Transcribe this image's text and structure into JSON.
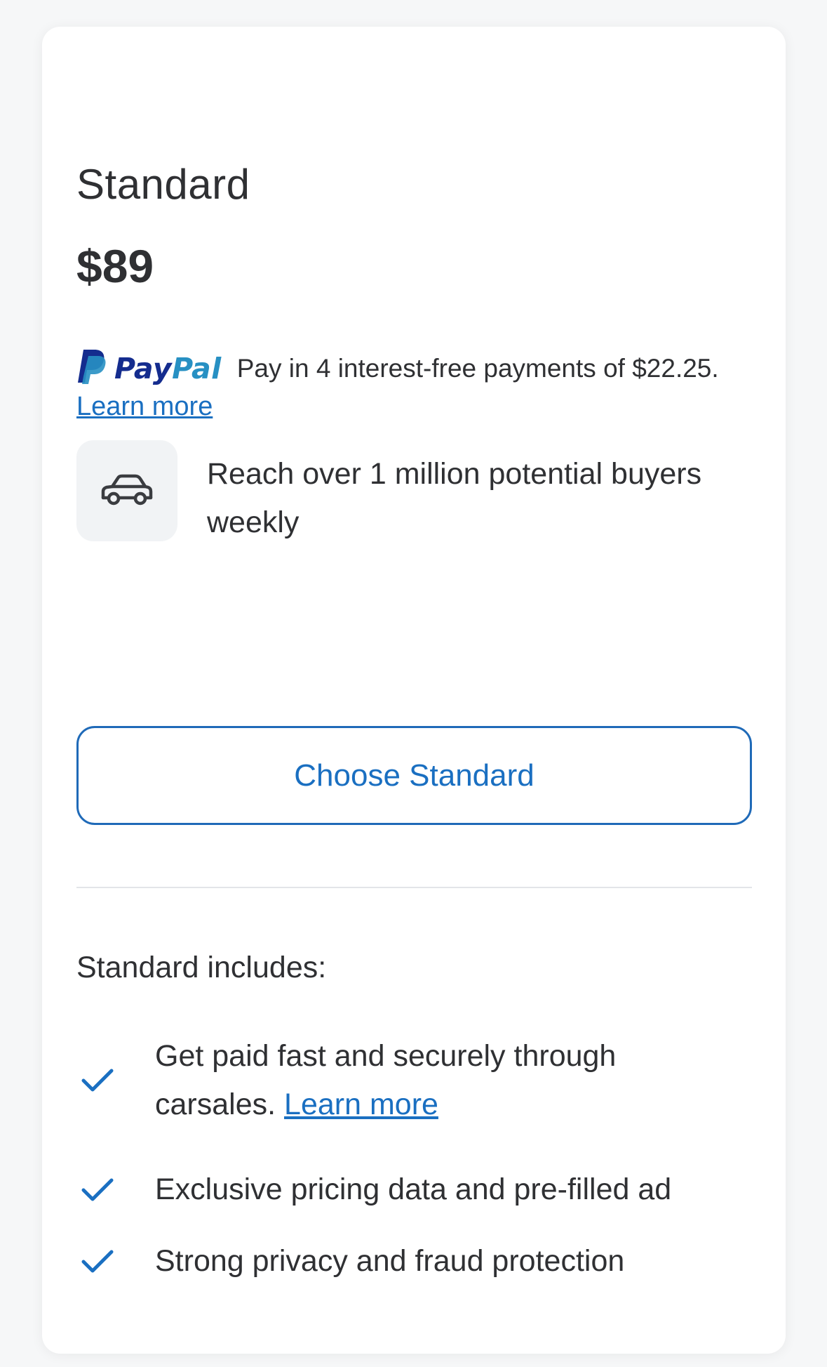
{
  "plan": {
    "name": "Standard",
    "price": "$89"
  },
  "paypal": {
    "logo_pay": "Pay",
    "logo_pal": "Pal",
    "text": "Pay in 4 interest-free payments of $22.25.",
    "learn_more": "Learn more",
    "colors": {
      "dark": "#142c8e",
      "light": "#2790c3"
    }
  },
  "feature": {
    "icon": "car-icon",
    "text": "Reach over 1 million potential buyers weekly"
  },
  "cta": {
    "label": "Choose Standard"
  },
  "includes": {
    "heading": "Standard includes:",
    "items": [
      {
        "text": "Get paid fast and securely through carsales.",
        "link": "Learn more",
        "icon": "check-icon"
      },
      {
        "text": "Exclusive pricing data and pre-filled ad",
        "icon": "check-icon"
      },
      {
        "text": "Strong privacy and fraud protection",
        "icon": "check-icon"
      }
    ]
  },
  "colors": {
    "accent": "#1a6fc1",
    "text": "#2f3033",
    "icon_bg": "#f1f3f5"
  }
}
